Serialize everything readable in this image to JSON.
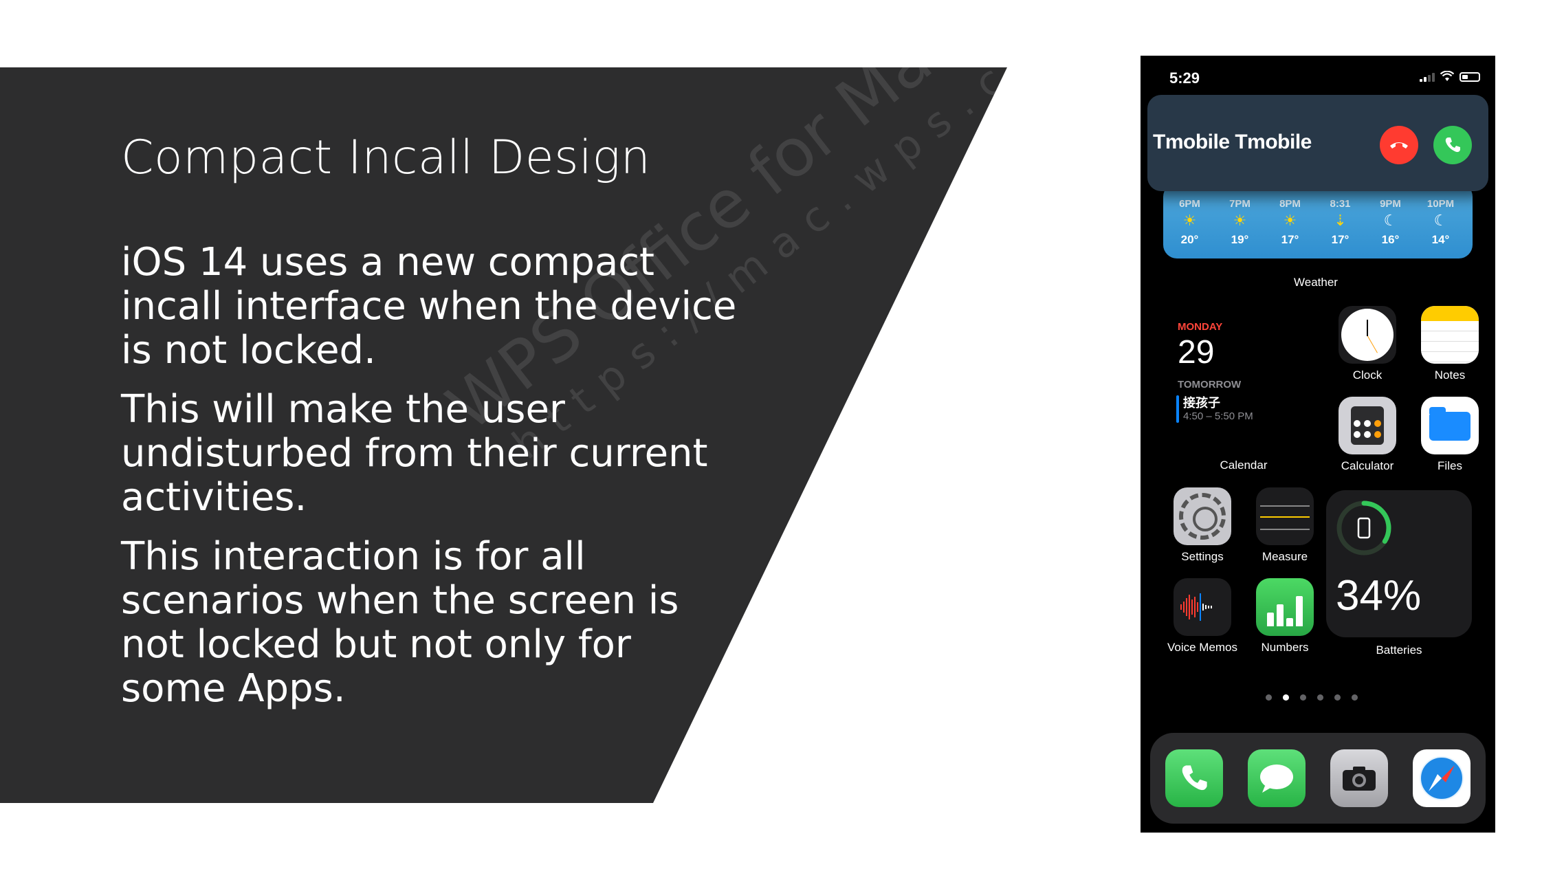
{
  "slide": {
    "title": "Compact Incall Design",
    "paragraphs": [
      "iOS 14 uses a new compact incall interface when the device is not locked.",
      "This will make the user undisturbed from their current activities.",
      "This interaction is for all scenarios when the screen is not locked but not only for some Apps."
    ],
    "watermark_line1": "WPS Office for Mac",
    "watermark_line2": "https://mac.wps.cn/"
  },
  "phone": {
    "status_time": "5:29",
    "call": {
      "caller": "Tmobile Tmobile",
      "decline_icon": "phone-down-icon",
      "accept_icon": "phone-icon"
    },
    "weather": {
      "label": "Weather",
      "hours": [
        {
          "time": "6PM",
          "icon": "sun-icon",
          "temp": "20°"
        },
        {
          "time": "7PM",
          "icon": "sun-icon",
          "temp": "19°"
        },
        {
          "time": "8PM",
          "icon": "sun-icon",
          "temp": "17°"
        },
        {
          "time": "8:31",
          "icon": "sunset-icon",
          "temp": "17°"
        },
        {
          "time": "9PM",
          "icon": "moon-icon",
          "temp": "16°"
        },
        {
          "time": "10PM",
          "icon": "moon-icon",
          "temp": "14°"
        }
      ]
    },
    "calendar": {
      "day": "MONDAY",
      "date": "29",
      "tomorrow": "TOMORROW",
      "event_title": "接孩子",
      "event_time": "4:50 – 5:50 PM",
      "label": "Calendar"
    },
    "apps": {
      "clock": "Clock",
      "notes": "Notes",
      "calculator": "Calculator",
      "files": "Files",
      "settings": "Settings",
      "measure": "Measure",
      "voice_memos": "Voice Memos",
      "numbers": "Numbers"
    },
    "batteries": {
      "percent": "34%",
      "level": 0.34,
      "label": "Batteries"
    },
    "page_dots": {
      "count": 6,
      "active_index": 1
    },
    "dock": [
      "Phone",
      "Messages",
      "Camera",
      "Safari"
    ]
  },
  "colors": {
    "slide_dark": "#2d2d2e",
    "decline": "#ff3b30",
    "accept": "#34c759",
    "weather_bg": "#3a9ad6",
    "calendar_accent": "#ff453a"
  }
}
